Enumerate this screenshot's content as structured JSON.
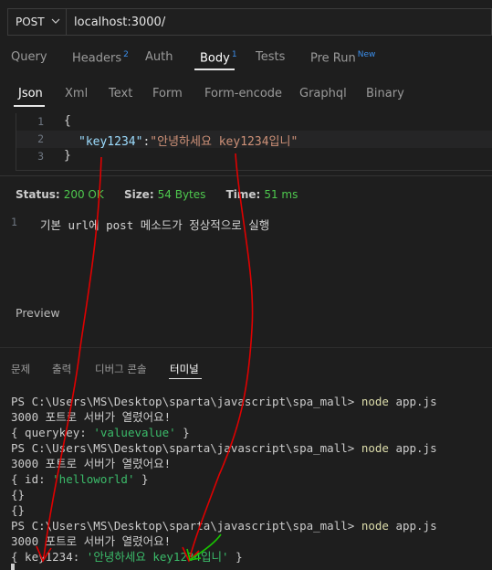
{
  "request": {
    "method": "POST",
    "url": "localhost:3000/"
  },
  "request_tabs": [
    {
      "label": "Query",
      "badge": ""
    },
    {
      "label": "Headers",
      "badge": "2"
    },
    {
      "label": "Auth",
      "badge": ""
    },
    {
      "label": "Body",
      "badge": "1"
    },
    {
      "label": "Tests",
      "badge": ""
    },
    {
      "label": "Pre Run",
      "badge": "New"
    }
  ],
  "body_tabs": [
    "Json",
    "Xml",
    "Text",
    "Form",
    "Form-encode",
    "Graphql",
    "Binary"
  ],
  "editor": {
    "line_numbers": [
      "1",
      "2",
      "3"
    ],
    "line1": "{",
    "key": "\"key1234\"",
    "colon": ":",
    "value": "\"안녕하세요 key1234입니\"",
    "line3": "}"
  },
  "status": {
    "status_label": "Status:",
    "status_value": "200 OK",
    "size_label": "Size:",
    "size_value": "54 Bytes",
    "time_label": "Time:",
    "time_value": "51 ms"
  },
  "response": {
    "line_number": "1",
    "text": "기본 url에 post 메소드가 정상적으로 실행"
  },
  "preview_label": "Preview",
  "panel_tabs": [
    "문제",
    "출력",
    "디버그 콘솔",
    "터미널"
  ],
  "terminal": {
    "prompt": "PS C:\\Users\\MS\\Desktop\\sparta\\javascript\\spa_mall> ",
    "command": "node",
    "command_arg": " app.js",
    "server_msg": "3000 포트로 서버가 열렸어요!",
    "obj1_prefix": "{ querykey: ",
    "obj1_value": "'valuevalue'",
    "obj1_suffix": " }",
    "obj2_prefix": "{ id: ",
    "obj2_value": "'helloworld'",
    "obj2_suffix": " }",
    "empty_obj": "{}",
    "obj3_prefix": "{ key1234: ",
    "obj3_value": "'안녕하세요 key1234입니'",
    "obj3_suffix": " }"
  },
  "colors": {
    "accent_blue": "#3b8eea",
    "status_green": "#4ec94e",
    "annotation_red": "#e00000",
    "annotation_green": "#18c400"
  }
}
